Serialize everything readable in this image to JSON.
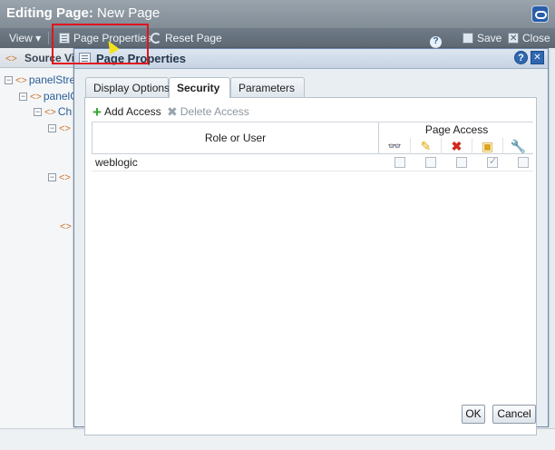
{
  "editor": {
    "title_prefix": "Editing Page:",
    "title_name": "New Page",
    "toolbar": {
      "view_label": "View",
      "view_arrow": "▾",
      "page_properties_label": "Page Properties",
      "reset_page_label": "Reset Page",
      "save_label": "Save",
      "close_label": "Close"
    }
  },
  "source_view": {
    "title": "Source Vi",
    "tree": [
      "panelStre",
      "panelG",
      "Ch"
    ]
  },
  "dialog": {
    "title": "Page Properties",
    "help_glyph": "?",
    "close_glyph": "✕",
    "tabs": [
      {
        "label": "Display Options",
        "active": false
      },
      {
        "label": "Security",
        "active": true
      },
      {
        "label": "Parameters",
        "active": false
      }
    ],
    "security": {
      "add_access_label": "Add Access",
      "delete_access_label": "Delete Access",
      "columns": {
        "role": "Role or User",
        "page_access": "Page Access",
        "permission_icons": [
          "view-icon",
          "edit-icon",
          "delete-icon",
          "customize-icon",
          "manage-icon"
        ]
      },
      "rows": [
        {
          "role": "weblogic",
          "permissions": [
            false,
            false,
            false,
            true,
            false
          ]
        }
      ]
    },
    "ok_label": "OK",
    "cancel_label": "Cancel"
  }
}
